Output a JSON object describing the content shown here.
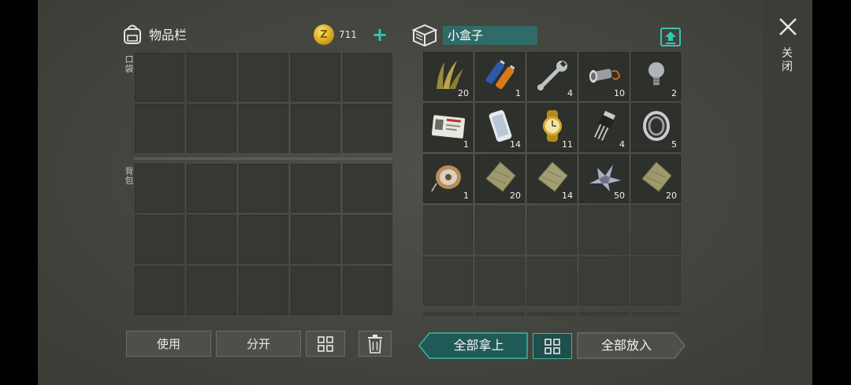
{
  "inventory": {
    "title": "物品栏",
    "coins": "711",
    "pocket_label": "口袋",
    "backpack_label": "背包"
  },
  "buttons": {
    "use": "使用",
    "split": "分开"
  },
  "container": {
    "name": "小盒子",
    "take_all": "全部拿上",
    "put_all": "全部放入",
    "items": [
      {
        "icon": "plant-fiber-icon",
        "count": "20"
      },
      {
        "icon": "battery-icon",
        "count": "1"
      },
      {
        "icon": "wrench-icon",
        "count": "4"
      },
      {
        "icon": "flashlight-icon",
        "count": "10"
      },
      {
        "icon": "light-bulb-icon",
        "count": "2"
      },
      {
        "icon": "id-card-icon",
        "count": "1"
      },
      {
        "icon": "smartphone-icon",
        "count": "14"
      },
      {
        "icon": "gold-watch-icon",
        "count": "11"
      },
      {
        "icon": "transistor-icon",
        "count": "4"
      },
      {
        "icon": "bearing-icon",
        "count": "5"
      },
      {
        "icon": "wire-spool-icon",
        "count": "1"
      },
      {
        "icon": "cloth-scrap-icon",
        "count": "20"
      },
      {
        "icon": "cloth-scrap-icon",
        "count": "14"
      },
      {
        "icon": "metal-scrap-icon",
        "count": "50"
      },
      {
        "icon": "cloth-scrap-icon",
        "count": "20"
      }
    ]
  },
  "close_label": "关闭",
  "colors": {
    "accent": "#36c5b5",
    "panel_teal": "#2f6c68"
  }
}
